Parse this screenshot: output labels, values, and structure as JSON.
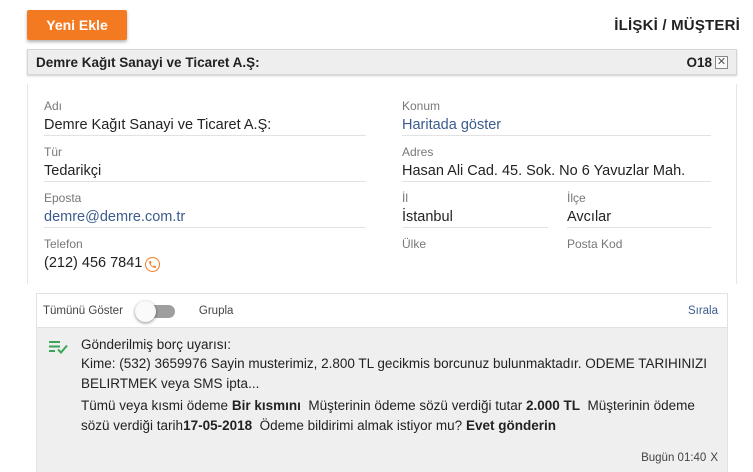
{
  "header": {
    "new_button_label": "Yeni Ekle",
    "page_title": "İLİŞKİ / MÜŞTERİ"
  },
  "record": {
    "name": "Demre Kağıt Sanayi ve Ticaret A.Ş:",
    "code": "O18",
    "close_glyph": "✕"
  },
  "fields": {
    "name_label": "Adı",
    "name_value": "Demre Kağıt Sanayi ve Ticaret A.Ş:",
    "location_label": "Konum",
    "location_value": "Haritada göster",
    "type_label": "Tür",
    "type_value": "Tedarikçi",
    "address_label": "Adres",
    "address_value": "Hasan Ali Cad. 45. Sok. No 6 Yavuzlar Mah.",
    "email_label": "Eposta",
    "email_value": "demre@demre.com.tr",
    "city_label": "İl",
    "city_value": "İstanbul",
    "district_label": "İlçe",
    "district_value": "Avcılar",
    "phone_label": "Telefon",
    "phone_value": "(212) 456 7841",
    "country_label": "Ülke",
    "postal_label": "Posta Kod"
  },
  "feed": {
    "show_all_label": "Tümünü Göster",
    "toggle_on": false,
    "group_label": "Grupla",
    "sort_label": "Sırala"
  },
  "activity": {
    "title": "Gönderilmiş borç uyarısı:",
    "body": "Kime: (532) 3659976 Sayin musterimiz, 2.800 TL gecikmis borcunuz bulunmaktadır. ODEME TARIHINIZI BELIRTMEK veya SMS ipta...",
    "q1": "Tümü veya kısmi ödeme",
    "a1": "Bir kısmını",
    "q2": "Müşterinin ödeme sözü verdiği tutar",
    "a2": "2.000 TL",
    "q3": "Müşterinin ödeme sözü verdiği tarih",
    "a3": "17-05-2018",
    "q4": "Ödeme bildirimi almak istiyor mu?",
    "a4": "Evet gönderin",
    "time": "Bugün 01:40",
    "dismiss": "X"
  },
  "colors": {
    "accent": "#f47a22",
    "link": "#3b5c8c",
    "check_icon": "#3aa655"
  }
}
